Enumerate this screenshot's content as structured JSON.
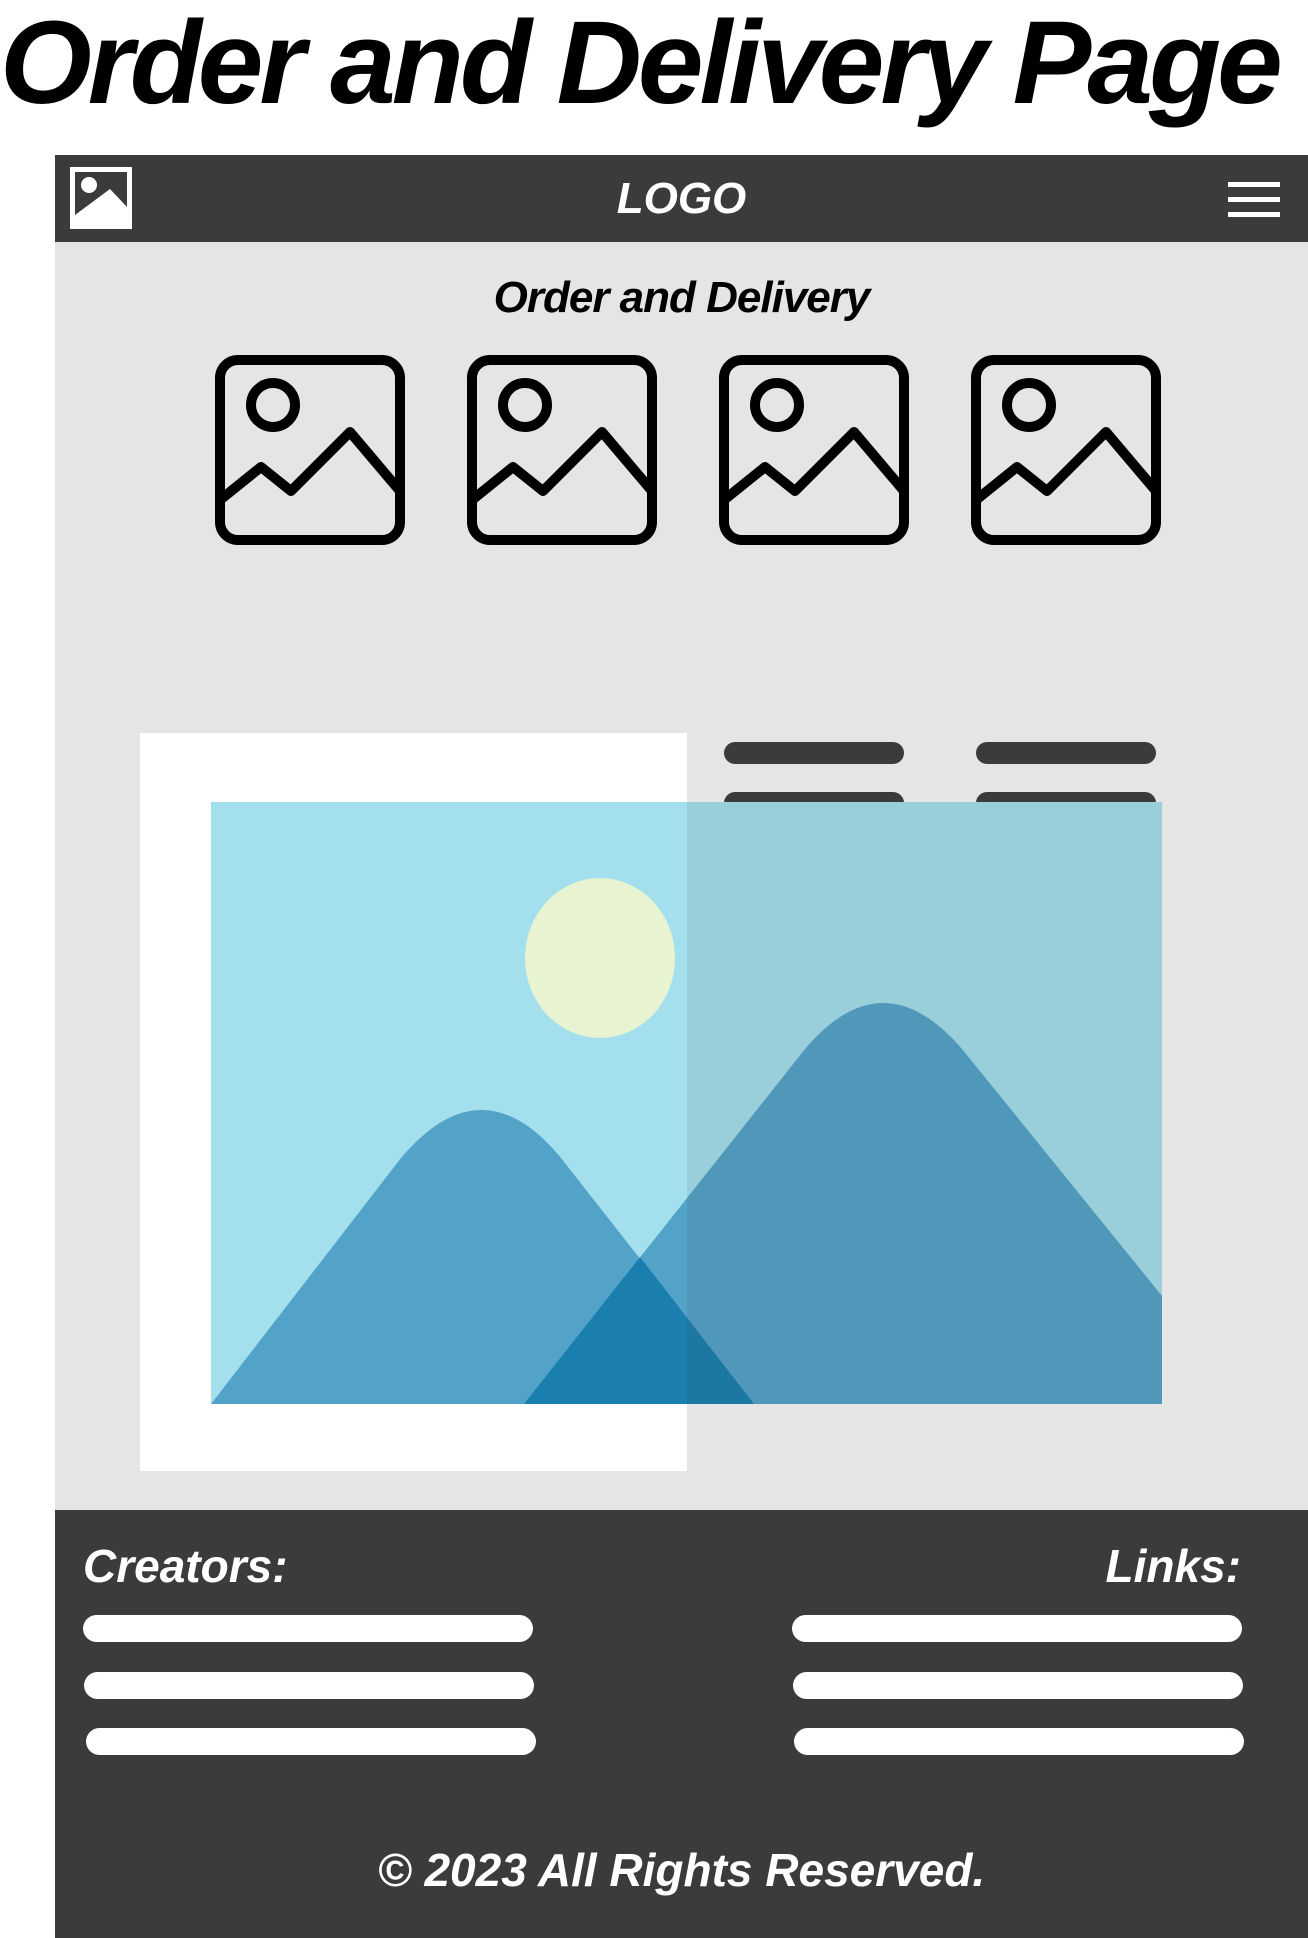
{
  "page_heading": "Order and Delivery Page",
  "header": {
    "logo_text": "LOGO",
    "logo_icon": "image-icon",
    "menu_icon": "hamburger-menu-icon"
  },
  "main": {
    "section_title": "Order and Delivery",
    "product_icon": "image-placeholder-icon",
    "product_count": 4
  },
  "footer": {
    "creators_label": "Creators:",
    "links_label": "Links:",
    "copyright": "© 2023 All Rights Reserved."
  },
  "colors": {
    "bar": "#3b3b3b",
    "page_background": "#e5e5e5",
    "sky": "#a4dfee",
    "sun": "#e8f3d1",
    "mountain": "#4f9fc6"
  }
}
